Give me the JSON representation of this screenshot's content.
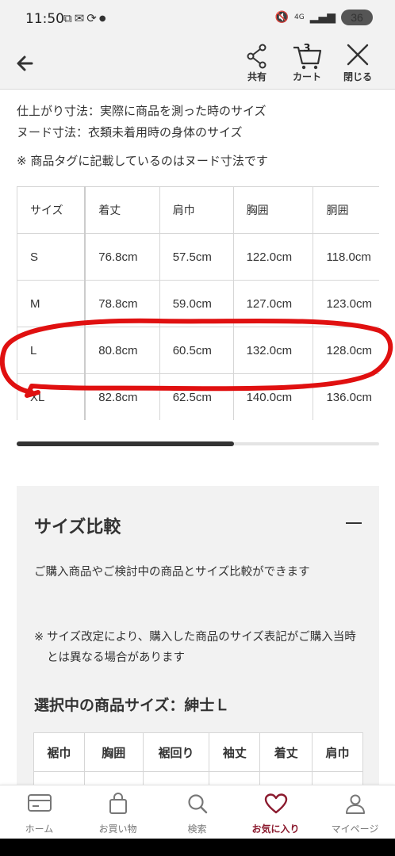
{
  "status_bar": {
    "time": "11:50",
    "left_icons": [
      "screenshot-icon",
      "mail-icon",
      "sync-icon",
      "dot-icon"
    ],
    "network": "4G",
    "battery": "36"
  },
  "header": {
    "share_label": "共有",
    "cart_label": "カート",
    "cart_count": "3",
    "close_label": "閉じる"
  },
  "notes": {
    "line1": "仕上がり寸法：実際に商品を測った時のサイズ",
    "line2": "ヌード寸法：衣類未着用時の身体のサイズ",
    "tag_note": "※ 商品タグに記載しているのはヌード寸法です"
  },
  "size_table": {
    "headers": [
      "サイズ",
      "着丈",
      "肩巾",
      "胸囲",
      "胴囲",
      ""
    ],
    "rows": [
      [
        "S",
        "76.8cm",
        "57.5cm",
        "122.0cm",
        "118.0cm",
        ""
      ],
      [
        "M",
        "78.8cm",
        "59.0cm",
        "127.0cm",
        "123.0cm",
        ""
      ],
      [
        "L",
        "80.8cm",
        "60.5cm",
        "132.0cm",
        "128.0cm",
        ""
      ],
      [
        "XL",
        "82.8cm",
        "62.5cm",
        "140.0cm",
        "136.0cm",
        ""
      ]
    ],
    "scroll_progress": 0.6
  },
  "compare": {
    "title": "サイズ比較",
    "description": "ご購入商品やご検討中の商品とサイズ比較ができます",
    "note_mark": "※",
    "note": "サイズ改定により、購入した商品のサイズ表記がご購入当時とは異なる場合があります",
    "selected_size": "選択中の商品サイズ：紳士Ｌ",
    "headers": [
      "裾巾",
      "胸囲",
      "裾回り",
      "袖丈",
      "着丈",
      "肩巾"
    ]
  },
  "bottom_nav": {
    "items": [
      {
        "label": "ホーム",
        "icon": "card-icon"
      },
      {
        "label": "お買い物",
        "icon": "bag-icon"
      },
      {
        "label": "検索",
        "icon": "search-icon"
      },
      {
        "label": "お気に入り",
        "icon": "heart-icon"
      },
      {
        "label": "マイページ",
        "icon": "person-icon"
      }
    ],
    "active_index": 3,
    "active_color": "#8b1a2e"
  },
  "colors": {
    "header_bg": "#f2f2f2",
    "annotation_red": "#e01010",
    "accent": "#8b1a2e"
  }
}
